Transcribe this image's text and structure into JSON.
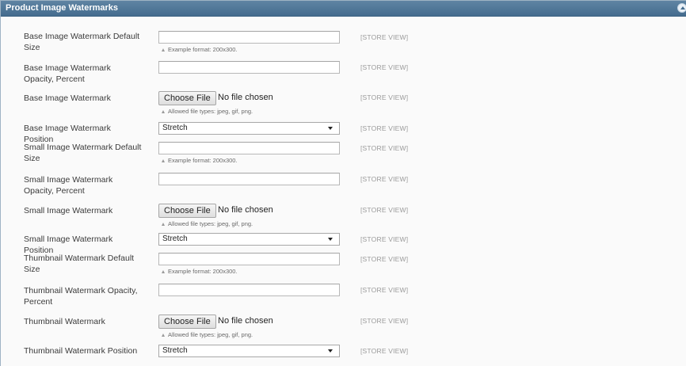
{
  "section": {
    "title": "Product Image Watermarks"
  },
  "scope_label": "[STORE VIEW]",
  "file_input": {
    "button_label": "Choose File",
    "status": "No file chosen"
  },
  "size_note": "Example format: 200x300.",
  "file_note": "Allowed file types: jpeg, gif, png.",
  "fields": {
    "base_size": {
      "label": "Base Image Watermark Default Size",
      "value": ""
    },
    "base_opacity": {
      "label": "Base Image Watermark Opacity, Percent",
      "value": ""
    },
    "base_image": {
      "label": "Base Image Watermark"
    },
    "base_position": {
      "label": "Base Image Watermark Position",
      "value": "Stretch"
    },
    "small_size": {
      "label": "Small Image Watermark Default Size",
      "value": ""
    },
    "small_opacity": {
      "label": "Small Image Watermark Opacity, Percent",
      "value": ""
    },
    "small_image": {
      "label": "Small Image Watermark"
    },
    "small_position": {
      "label": "Small Image Watermark Position",
      "value": "Stretch"
    },
    "thumb_size": {
      "label": "Thumbnail Watermark Default Size",
      "value": ""
    },
    "thumb_opacity": {
      "label": "Thumbnail Watermark Opacity, Percent",
      "value": ""
    },
    "thumb_image": {
      "label": "Thumbnail Watermark"
    },
    "thumb_position": {
      "label": "Thumbnail Watermark Position",
      "value": "Stretch"
    }
  }
}
